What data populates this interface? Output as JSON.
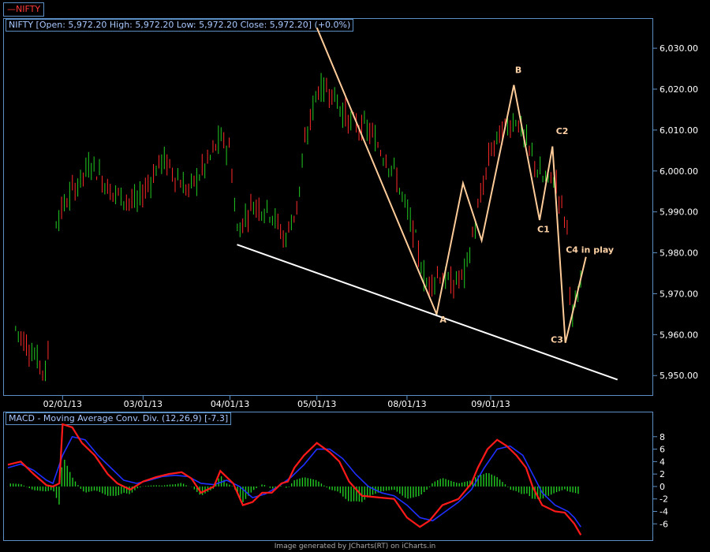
{
  "legend": "—NIFTY",
  "price_title": "NIFTY [Open: 5,972.20  High: 5,972.20  Low: 5,972.20  Close: 5,972.20] (+0.0%)",
  "macd_title": "MACD - Moving Average Conv. Div. (12,26,9) [-7.3]",
  "footer": "Image generated by JCharts(RT) on iCharts.in",
  "colors": {
    "up": "#22cc22",
    "down": "#ff2a2a",
    "macd": "#ff1a1a",
    "signal": "#1f2fff",
    "pattern": "#ffcc99",
    "trendline": "#ffffff",
    "axis": "#5b8fc4"
  },
  "chart_data": [
    {
      "type": "candlestick",
      "x_labels": [
        "02/01/13",
        "03/01/13",
        "04/01/13",
        "05/01/13",
        "08/01/13",
        "09/01/13"
      ],
      "y_ticks": [
        "5,950.00",
        "5,960.00",
        "5,970.00",
        "5,980.00",
        "5,990.00",
        "6,000.00",
        "6,010.00",
        "6,020.00",
        "6,030.00"
      ],
      "ylim": [
        5946,
        6036
      ],
      "xlim": [
        0,
        1
      ],
      "pattern_line": [
        [
          0.48,
          6035
        ],
        [
          0.666,
          5965
        ],
        [
          0.707,
          5997
        ],
        [
          0.736,
          5983
        ],
        [
          0.786,
          6021
        ],
        [
          0.826,
          5988
        ],
        [
          0.846,
          6006
        ],
        [
          0.866,
          5958
        ],
        [
          0.898,
          5979
        ]
      ],
      "trendline": [
        [
          0.356,
          5982
        ],
        [
          0.947,
          5949
        ]
      ],
      "annotations": [
        {
          "label": "A",
          "x": 0.676,
          "y": 5963
        },
        {
          "label": "B",
          "x": 0.793,
          "y": 6024
        },
        {
          "label": "C1",
          "x": 0.832,
          "y": 5985
        },
        {
          "label": "C2",
          "x": 0.861,
          "y": 6009
        },
        {
          "label": "C3",
          "x": 0.853,
          "y": 5958
        },
        {
          "label": "C4 in play",
          "x": 0.904,
          "y": 5980
        }
      ]
    },
    {
      "type": "macd",
      "y_ticks": [
        "-6",
        "-4",
        "-2",
        "0",
        "2",
        "4",
        "6",
        "8"
      ],
      "ylim": [
        -8.5,
        10
      ],
      "macd_line": [
        [
          0,
          3.5
        ],
        [
          0.02,
          4
        ],
        [
          0.04,
          2
        ],
        [
          0.06,
          0.2
        ],
        [
          0.07,
          0
        ],
        [
          0.08,
          0.5
        ],
        [
          0.085,
          10
        ],
        [
          0.1,
          9.5
        ],
        [
          0.115,
          7
        ],
        [
          0.135,
          5
        ],
        [
          0.155,
          2
        ],
        [
          0.17,
          0.5
        ],
        [
          0.19,
          -0.5
        ],
        [
          0.21,
          0.8
        ],
        [
          0.23,
          1.5
        ],
        [
          0.25,
          2
        ],
        [
          0.27,
          2.3
        ],
        [
          0.285,
          1.3
        ],
        [
          0.3,
          -1
        ],
        [
          0.32,
          0
        ],
        [
          0.33,
          2.5
        ],
        [
          0.35,
          0.5
        ],
        [
          0.365,
          -3
        ],
        [
          0.38,
          -2.5
        ],
        [
          0.395,
          -1
        ],
        [
          0.41,
          -1
        ],
        [
          0.425,
          0.5
        ],
        [
          0.435,
          0.8
        ],
        [
          0.445,
          3
        ],
        [
          0.46,
          5
        ],
        [
          0.48,
          7
        ],
        [
          0.5,
          5.5
        ],
        [
          0.515,
          4
        ],
        [
          0.53,
          0.8
        ],
        [
          0.55,
          -1.5
        ],
        [
          0.58,
          -1.8
        ],
        [
          0.6,
          -2
        ],
        [
          0.62,
          -5
        ],
        [
          0.64,
          -6.5
        ],
        [
          0.655,
          -5.5
        ],
        [
          0.675,
          -3
        ],
        [
          0.7,
          -2
        ],
        [
          0.72,
          0.5
        ],
        [
          0.73,
          3
        ],
        [
          0.745,
          6
        ],
        [
          0.76,
          7.5
        ],
        [
          0.775,
          6.5
        ],
        [
          0.79,
          5
        ],
        [
          0.805,
          3
        ],
        [
          0.815,
          0
        ],
        [
          0.83,
          -3
        ],
        [
          0.85,
          -4
        ],
        [
          0.865,
          -4.2
        ],
        [
          0.88,
          -6
        ],
        [
          0.89,
          -7.8
        ]
      ],
      "signal_line": [
        [
          0,
          3
        ],
        [
          0.02,
          3.6
        ],
        [
          0.04,
          2.6
        ],
        [
          0.06,
          1
        ],
        [
          0.07,
          0.5
        ],
        [
          0.085,
          5
        ],
        [
          0.1,
          8
        ],
        [
          0.12,
          7.5
        ],
        [
          0.14,
          5
        ],
        [
          0.16,
          3
        ],
        [
          0.18,
          1
        ],
        [
          0.2,
          0.5
        ],
        [
          0.22,
          1
        ],
        [
          0.24,
          1.6
        ],
        [
          0.26,
          1.8
        ],
        [
          0.28,
          1.6
        ],
        [
          0.3,
          0.5
        ],
        [
          0.32,
          0.3
        ],
        [
          0.34,
          1
        ],
        [
          0.36,
          0
        ],
        [
          0.38,
          -1.8
        ],
        [
          0.4,
          -1.2
        ],
        [
          0.42,
          0
        ],
        [
          0.44,
          1.5
        ],
        [
          0.46,
          3.5
        ],
        [
          0.48,
          6
        ],
        [
          0.5,
          6
        ],
        [
          0.52,
          4.5
        ],
        [
          0.54,
          2
        ],
        [
          0.56,
          0
        ],
        [
          0.58,
          -1
        ],
        [
          0.6,
          -1.5
        ],
        [
          0.62,
          -3
        ],
        [
          0.64,
          -5
        ],
        [
          0.66,
          -5.5
        ],
        [
          0.68,
          -4
        ],
        [
          0.7,
          -2.5
        ],
        [
          0.72,
          -0.5
        ],
        [
          0.74,
          3
        ],
        [
          0.76,
          6
        ],
        [
          0.78,
          6.5
        ],
        [
          0.8,
          5
        ],
        [
          0.815,
          2
        ],
        [
          0.83,
          -1
        ],
        [
          0.85,
          -3
        ],
        [
          0.87,
          -4
        ],
        [
          0.88,
          -5
        ],
        [
          0.89,
          -6.5
        ]
      ]
    }
  ]
}
